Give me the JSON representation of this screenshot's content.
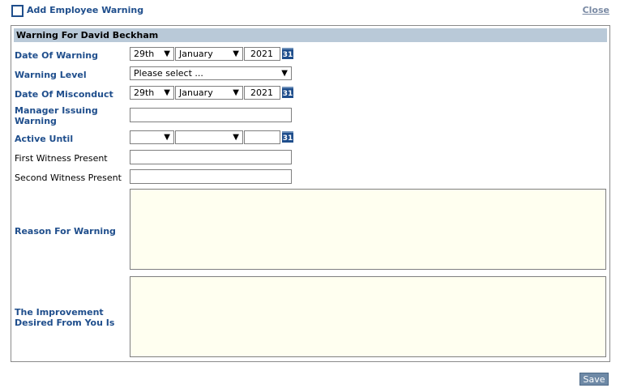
{
  "header": {
    "title": "Add Employee Warning",
    "close_label": "Close"
  },
  "panel": {
    "title": "Warning For David Beckham"
  },
  "fields": {
    "date_of_warning": {
      "label": "Date Of Warning",
      "day": "29th",
      "month": "January",
      "year": "2021"
    },
    "warning_level": {
      "label": "Warning Level",
      "value": "Please select ..."
    },
    "date_of_misconduct": {
      "label": "Date Of Misconduct",
      "day": "29th",
      "month": "January",
      "year": "2021"
    },
    "manager_issuing": {
      "label_line1": "Manager Issuing",
      "label_line2": "Warning"
    },
    "active_until": {
      "label": "Active Until",
      "day": "",
      "month": "",
      "year": ""
    },
    "first_witness": {
      "label": "First Witness Present"
    },
    "second_witness": {
      "label": "Second Witness Present"
    },
    "reason": {
      "label": "Reason For Warning"
    },
    "improvement": {
      "label_line1": "The Improvement",
      "label_line2": "Desired From You Is"
    }
  },
  "calendar_icon_text": "31",
  "icons": {
    "chevron": "▼",
    "header": "checkbox-icon"
  },
  "save_label": "Save",
  "colors": {
    "accent": "#1f4e8c",
    "panel_header_bg": "#b9c9d8",
    "textarea_bg": "#fffff0",
    "save_bg": "#6e89a6"
  }
}
